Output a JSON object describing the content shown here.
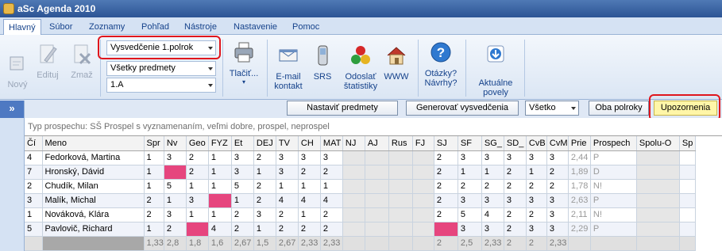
{
  "window": {
    "title": "aSc Agenda 2010"
  },
  "menu": [
    "Hlavný",
    "Súbor",
    "Zoznamy",
    "Pohľad",
    "Nástroje",
    "Nastavenie",
    "Pomoc"
  ],
  "ribbon": {
    "new": "Nový",
    "edit": "Edituj",
    "delete": "Zmaž",
    "combo1": "Vysvedčenie 1.polrok",
    "combo2": "Všetky predmety",
    "combo3": "1.A",
    "print": "Tlačiť...",
    "email_line1": "E-mail",
    "email_line2": "kontakt",
    "srs": "SRS",
    "stats_line1": "Odoslať",
    "stats_line2": "štatistiky",
    "www": "WWW",
    "help_line1": "Otázky?",
    "help_line2": "Návrhy?",
    "update_line1": "Aktuálne",
    "update_line2": "povely"
  },
  "toolbar2": {
    "expander": "»",
    "set_subjects": "Nastaviť predmety",
    "generate": "Generovať vysvedčenia",
    "filter": "Všetko",
    "both_terms": "Oba polroky",
    "warnings": "Upozornenia"
  },
  "type_line": "Typ prospechu: SŠ Prospel s vyznamenaním, veľmi dobre, prospel, neprospel",
  "grid": {
    "columns": [
      "Čí",
      "Meno",
      "Spr",
      "Nv",
      "Geo",
      "FYZ",
      "Et",
      "DEJ",
      "TV",
      "CH",
      "MAT",
      "NJ",
      "AJ",
      "Rus",
      "FJ",
      "SJ",
      "SF",
      "SG_",
      "SD_",
      "CvB",
      "CvM",
      "Prie",
      "Prospech",
      "Spolu-O",
      "Sp"
    ],
    "rows": [
      {
        "cells": [
          "4",
          "Fedorková, Martina",
          "1",
          "3",
          "2",
          "1",
          "3",
          "2",
          "3",
          "3",
          "3",
          "",
          "",
          "",
          "",
          "2",
          "3",
          "3",
          "3",
          "3",
          "3",
          "2,44",
          "P",
          "",
          ""
        ],
        "pink": []
      },
      {
        "cells": [
          "7",
          "Hronský, Dávid",
          "1",
          "",
          "2",
          "1",
          "3",
          "1",
          "3",
          "2",
          "2",
          "",
          "",
          "",
          "",
          "2",
          "1",
          "1",
          "2",
          "1",
          "2",
          "1,89",
          "D",
          "",
          ""
        ],
        "pink": [
          3
        ]
      },
      {
        "cells": [
          "2",
          "Chudík, Milan",
          "1",
          "5",
          "1",
          "1",
          "5",
          "2",
          "1",
          "1",
          "1",
          "",
          "",
          "",
          "",
          "2",
          "2",
          "2",
          "2",
          "2",
          "2",
          "1,78",
          "N!",
          "",
          ""
        ],
        "pink": []
      },
      {
        "cells": [
          "3",
          "Malík, Michal",
          "2",
          "1",
          "3",
          "",
          "1",
          "2",
          "4",
          "4",
          "4",
          "",
          "",
          "",
          "",
          "2",
          "3",
          "3",
          "3",
          "3",
          "3",
          "2,63",
          "P",
          "",
          ""
        ],
        "pink": [
          5
        ]
      },
      {
        "cells": [
          "1",
          "Nováková, Klára",
          "2",
          "3",
          "1",
          "1",
          "2",
          "3",
          "2",
          "1",
          "2",
          "",
          "",
          "",
          "",
          "2",
          "5",
          "4",
          "2",
          "2",
          "3",
          "2,11",
          "N!",
          "",
          ""
        ],
        "pink": []
      },
      {
        "cells": [
          "5",
          "Pavlovič, Richard",
          "1",
          "2",
          "",
          "4",
          "2",
          "1",
          "2",
          "2",
          "2",
          "",
          "",
          "",
          "",
          "",
          "3",
          "3",
          "2",
          "3",
          "3",
          "2,29",
          "P",
          "",
          ""
        ],
        "pink": [
          4,
          15
        ]
      }
    ],
    "summary": [
      "",
      "",
      "1,33",
      "2,8",
      "1,8",
      "1,6",
      "2,67",
      "1,5",
      "2,67",
      "2,33",
      "2,33",
      "",
      "",
      "",
      "",
      "2",
      "2,5",
      "2,33",
      "2",
      "2",
      "2,33",
      "",
      "",
      "",
      ""
    ]
  },
  "colors": {
    "highlight": "#e6457e",
    "annotation": "#e0161d",
    "accent": "#2c5494"
  }
}
